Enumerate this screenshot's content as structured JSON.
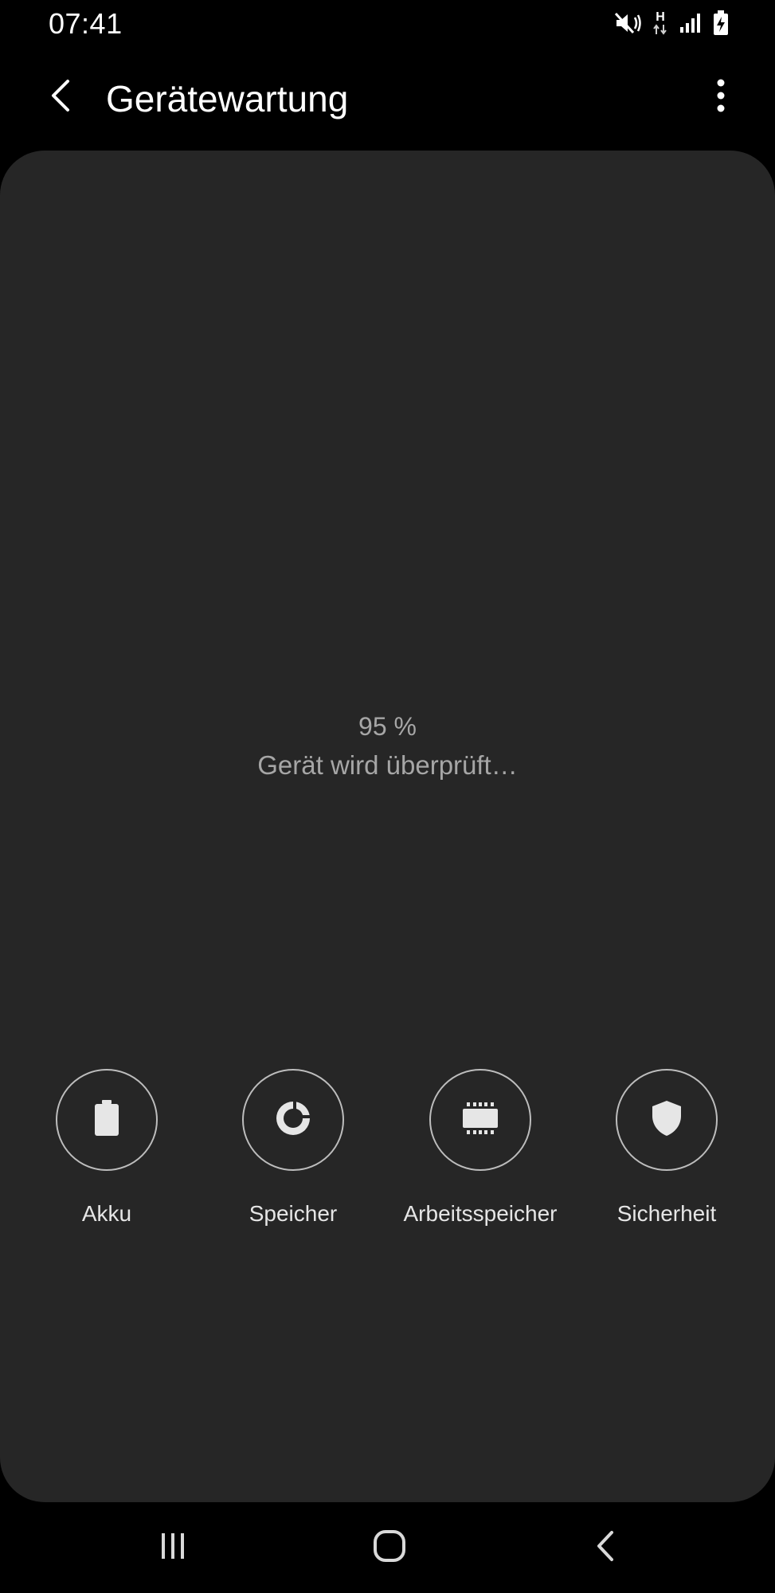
{
  "status_bar": {
    "time": "07:41",
    "icons": [
      "mute-vibrate-icon",
      "hspa-data-icon",
      "signal-icon",
      "battery-charging-icon"
    ],
    "network_label": "H"
  },
  "app_bar": {
    "title": "Gerätewartung",
    "back_icon": "back-arrow-icon",
    "menu_icon": "more-vertical-icon"
  },
  "scan": {
    "percent": "95 %",
    "status": "Gerät wird überprüft…"
  },
  "categories": [
    {
      "label": "Akku",
      "icon": "battery-icon"
    },
    {
      "label": "Speicher",
      "icon": "storage-pie-icon"
    },
    {
      "label": "Arbeitsspeicher",
      "icon": "memory-chip-icon"
    },
    {
      "label": "Sicherheit",
      "icon": "shield-icon"
    }
  ],
  "nav_bar": {
    "icons": [
      "recent-apps-icon",
      "home-icon",
      "back-icon"
    ]
  },
  "colors": {
    "background": "#000000",
    "card": "#262626",
    "muted_text": "#a6a6a6",
    "ring": "#bdbdbd",
    "icon": "#e6e6e6"
  }
}
